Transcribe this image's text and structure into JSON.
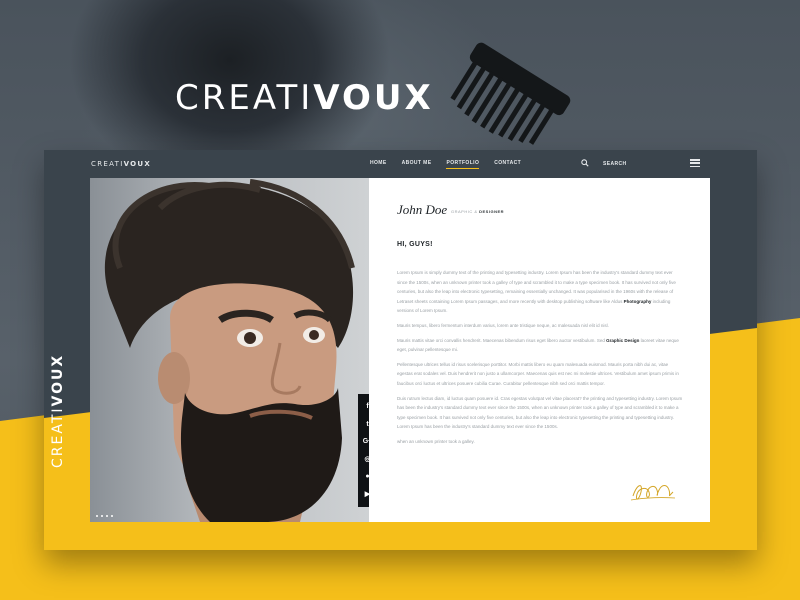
{
  "brand": {
    "light": "CREATI",
    "bold": "VOUX"
  },
  "nav": {
    "items": [
      {
        "label": "HOME",
        "active": false
      },
      {
        "label": "ABOUT ME",
        "active": false
      },
      {
        "label": "PORTFOLIO",
        "active": true
      },
      {
        "label": "CONTACT",
        "active": false
      }
    ],
    "search_icon": "search-icon",
    "search_label": "SEARCH",
    "menu_icon": "hamburger-icon"
  },
  "profile": {
    "name": "John Doe",
    "role_prefix": "GRAPHIC & ",
    "role_bold": "DESIGNER",
    "greeting": "HI, GUYS!",
    "paragraphs": [
      {
        "pre": "Lorem Ipsum is simply dummy text of the printing and typesetting industry. Lorem Ipsum has been the industry's standard dummy text ever since the 1500s, when an unknown printer took a galley of type and scrambled it to make a type specimen book. It has survived not only five centuries, but also the leap into electronic typesetting, remaining essentially unchanged. It was popularised in the 1960s with the release of Letraset sheets containing Lorem Ipsum passages, and more recently with desktop publishing software like Aldus ",
        "bold": "Photography",
        "post": " including versions of Lorem Ipsum."
      },
      {
        "pre": "Mauris tempus, libero fermentum interdum varius, lorem ante tristique neque, ac malesuada nisl elit id nisl.",
        "bold": "",
        "post": ""
      },
      {
        "pre": "Mauris mattis vitae orci convallis hendrerit. Maecenas bibendum risus eget libero auctor vestibulum. Sed ",
        "bold": "Graphic Design",
        "post": " laoreet vitae neque eget, pulvinar pellentesque mi."
      },
      {
        "pre": "Pellentesque ultrices tellus id risus scelerisque porttitor. Morbi mattis libero eu quam malesuada euismod. Mauris porta nibh dui ac, vitae egestas erat sodales vel. Duis hendrerit non justo a ullamcorper. Maecenas quis est nec mi molestie ultrices. Vestibulum amet ipsum primis in faucibus orci luctus et ultrices posuere cubilia Curae. Curabitur pellentesque nibh sed orci mattis tempor.",
        "bold": "",
        "post": ""
      },
      {
        "pre": "Duis rutrum lectus diam, id luctus quam posuere id. Cras egestas volutpat vel vitae placerat? the printing and typesetting industry. Lorem Ipsum has been the industry's standard dummy text ever since the 1500s, when an unknown printer took a galley of type and scrambled it to make a type specimen book. It has survived not only five centuries, but also the leap into electronic typesetting the printing and typesetting industry. Lorem Ipsum has been the industry's standard dummy text ever since the 1500s.",
        "bold": "",
        "post": ""
      },
      {
        "pre": "when an unknown printer took a galley.",
        "bold": "",
        "post": ""
      }
    ]
  },
  "social": [
    {
      "glyph": "f",
      "icon": "facebook-icon"
    },
    {
      "glyph": "t",
      "icon": "twitter-icon"
    },
    {
      "glyph": "G+",
      "icon": "google-plus-icon"
    },
    {
      "glyph": "◎",
      "icon": "instagram-icon"
    },
    {
      "glyph": "●",
      "icon": "pinterest-icon"
    },
    {
      "glyph": "▶",
      "icon": "youtube-icon"
    }
  ],
  "colors": {
    "accent": "#f5bf1a",
    "dark": "#3a444c",
    "text": "#1d2226",
    "muted": "#9aa0a5"
  }
}
